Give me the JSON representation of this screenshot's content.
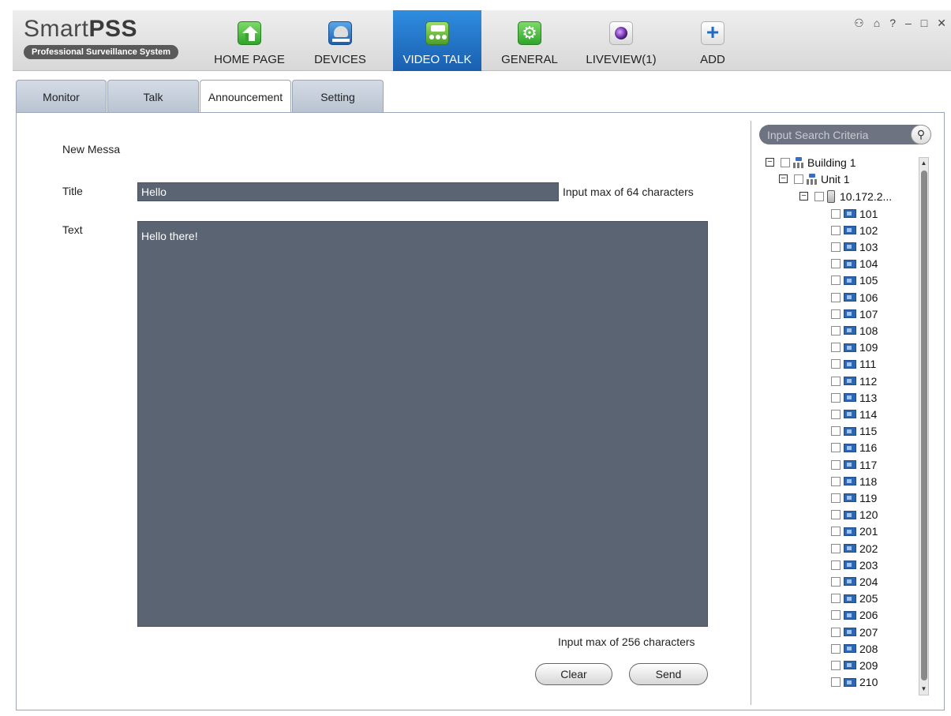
{
  "app": {
    "logo_main": "Smart",
    "logo_bold": "PSS",
    "logo_sub": "Professional Surveillance System"
  },
  "nav": [
    {
      "label": "HOME PAGE",
      "icon": "home-icon"
    },
    {
      "label": "DEVICES",
      "icon": "camera-dome-icon"
    },
    {
      "label": "VIDEO TALK",
      "icon": "video-talk-icon",
      "active": true
    },
    {
      "label": "GENERAL",
      "icon": "settings-gears-icon"
    },
    {
      "label": "LIVEVIEW(1)",
      "icon": "liveview-lens-icon"
    },
    {
      "label": "ADD",
      "icon": "plus-icon"
    }
  ],
  "window_controls": {
    "user": "⚇",
    "lock": "⌂",
    "help": "?",
    "minimize": "–",
    "maximize": "□",
    "close": "✕"
  },
  "tabs": [
    {
      "label": "Monitor"
    },
    {
      "label": "Talk"
    },
    {
      "label": "Announcement",
      "active": true
    },
    {
      "label": "Setting"
    }
  ],
  "form": {
    "section_label": "New Messa",
    "title_label": "Title",
    "title_value": "Hello",
    "title_hint": "Input max of 64 characters",
    "text_label": "Text",
    "text_value": "Hello there!",
    "text_hint": "Input max of 256 characters",
    "clear_label": "Clear",
    "send_label": "Send"
  },
  "search": {
    "placeholder": "Input Search Criteria"
  },
  "tree": {
    "building": "Building 1",
    "unit": "Unit 1",
    "device": "10.172.2...",
    "rooms": [
      "101",
      "102",
      "103",
      "104",
      "105",
      "106",
      "107",
      "108",
      "109",
      "111",
      "112",
      "113",
      "114",
      "115",
      "116",
      "117",
      "118",
      "119",
      "120",
      "201",
      "202",
      "203",
      "204",
      "205",
      "206",
      "207",
      "208",
      "209",
      "210"
    ]
  },
  "colors": {
    "accent": "#1f6bc7",
    "input_bg": "#5b6472",
    "tab_bg": "#c4ccd8"
  }
}
